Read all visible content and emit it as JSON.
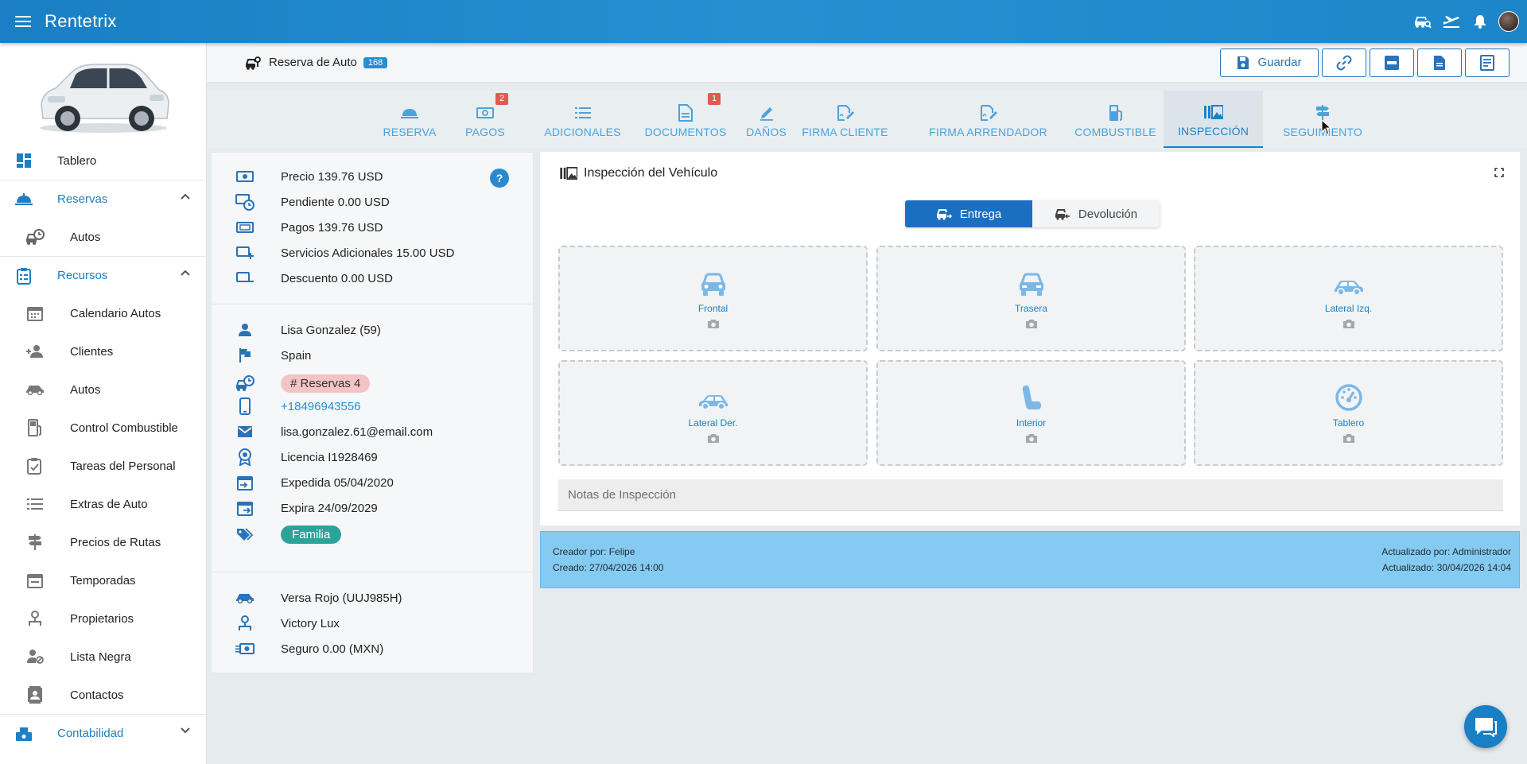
{
  "app": {
    "brand": "Rentetrix"
  },
  "colors": {
    "primary": "#1f7fc3",
    "accent": "#2490d2",
    "badge_red": "#e05a4f",
    "family_tag": "#2ca39a",
    "reservas_tag": "#f4c3c3",
    "meta_bar": "#85caf0"
  },
  "topbar_icons": [
    "car-search-icon",
    "plane-icon",
    "bell-icon",
    "avatar"
  ],
  "sidebar": {
    "items": [
      {
        "label": "Tablero",
        "icon": "dashboard-icon",
        "kind": "top"
      },
      {
        "label": "Reservas",
        "icon": "reservation-bell-icon",
        "kind": "group"
      },
      {
        "label": "Autos",
        "icon": "car-clock-icon",
        "kind": "sub"
      },
      {
        "label": "Recursos",
        "icon": "clipboard-icon",
        "kind": "group"
      },
      {
        "label": "Calendario Autos",
        "icon": "calendar-icon",
        "kind": "sub"
      },
      {
        "label": "Clientes",
        "icon": "users-icon",
        "kind": "sub"
      },
      {
        "label": "Autos",
        "icon": "car-icon",
        "kind": "sub"
      },
      {
        "label": "Control Combustible",
        "icon": "fuel-icon",
        "kind": "sub"
      },
      {
        "label": "Tareas del Personal",
        "icon": "task-icon",
        "kind": "sub"
      },
      {
        "label": "Extras de Auto",
        "icon": "list-icon",
        "kind": "sub"
      },
      {
        "label": "Precios de Rutas",
        "icon": "signpost-icon",
        "kind": "sub"
      },
      {
        "label": "Temporadas",
        "icon": "calendar-grid-icon",
        "kind": "sub"
      },
      {
        "label": "Propietarios",
        "icon": "owner-icon",
        "kind": "sub"
      },
      {
        "label": "Lista Negra",
        "icon": "user-block-icon",
        "kind": "sub"
      },
      {
        "label": "Contactos",
        "icon": "contacts-icon",
        "kind": "sub"
      },
      {
        "label": "Contabilidad",
        "icon": "accounting-icon",
        "kind": "group"
      }
    ]
  },
  "header": {
    "title": "Reserva de Auto",
    "count": "168",
    "save_label": "Guardar"
  },
  "tabs": [
    {
      "label": "RESERVA",
      "badge": ""
    },
    {
      "label": "PAGOS",
      "badge": "2"
    },
    {
      "label": "ADICIONALES",
      "badge": ""
    },
    {
      "label": "DOCUMENTOS",
      "badge": "1"
    },
    {
      "label": "DAÑOS",
      "badge": ""
    },
    {
      "label": "FIRMA CLIENTE",
      "badge": ""
    },
    {
      "label": "FIRMA ARRENDADOR",
      "badge": ""
    },
    {
      "label": "COMBUSTIBLE",
      "badge": ""
    },
    {
      "label": "INSPECCIÓN",
      "badge": ""
    },
    {
      "label": "SEGUIMIENTO",
      "badge": ""
    }
  ],
  "summary": {
    "price": "Precio 139.76 USD",
    "pending": "Pendiente 0.00 USD",
    "payments": "Pagos 139.76 USD",
    "extras": "Servicios Adicionales 15.00 USD",
    "discount": "Descuento 0.00 USD",
    "help": "?"
  },
  "customer": {
    "name": "Lisa Gonzalez (59)",
    "country": "Spain",
    "reservations": "# Reservas 4",
    "phone": "+18496943556",
    "email": "lisa.gonzalez.61@email.com",
    "license": "Licencia I1928469",
    "issued": "Expedida 05/04/2020",
    "expires": "Expira 24/09/2029",
    "tag": "Familia"
  },
  "vehicle": {
    "model": "Versa Rojo (UUJ985H)",
    "owner": "Victory Lux",
    "insurance": "Seguro 0.00 (MXN)"
  },
  "inspection": {
    "title": "Inspección del Vehículo",
    "delivery_label": "Entrega",
    "return_label": "Devolución",
    "slots": [
      {
        "label": "Frontal",
        "icon": "car-front-icon"
      },
      {
        "label": "Trasera",
        "icon": "car-back-icon"
      },
      {
        "label": "Lateral Izq.",
        "icon": "car-side-icon"
      },
      {
        "label": "Lateral Der.",
        "icon": "car-side-icon"
      },
      {
        "label": "Interior",
        "icon": "seat-icon"
      },
      {
        "label": "Tablero",
        "icon": "speedometer-icon"
      }
    ],
    "notes_placeholder": "Notas de Inspección"
  },
  "meta": {
    "created_by": "Creador por: Felipe",
    "created_at": "Creado: 27/04/2026 14:00",
    "updated_by": "Actualizado por: Administrador",
    "updated_at": "Actualizado: 30/04/2026 14:04"
  }
}
